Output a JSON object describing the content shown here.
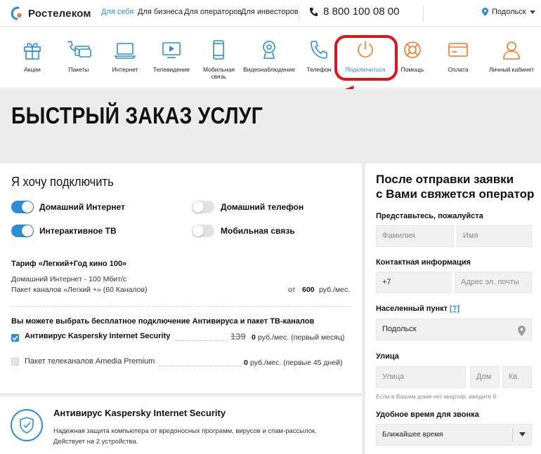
{
  "header": {
    "brand": "Ростелеком",
    "links": [
      "Для себя",
      "Для бизнеса",
      "Для операторов",
      "Для инвесторов"
    ],
    "phone": "8 800 100 08 00",
    "city": "Подольск"
  },
  "nav": {
    "items": [
      "Акции",
      "Пакеты",
      "Интернет",
      "Телевидение",
      "Мобильная связь",
      "Видеонаблюдение",
      "Телефон",
      "Подключиться",
      "Помощь",
      "Оплата",
      "Личный кабинет"
    ],
    "selected": "Подключиться"
  },
  "hero": {
    "title": "БЫСТРЫЙ ЗАКАЗ УСЛУГ"
  },
  "order": {
    "title": "Я хочу подключить",
    "toggles": [
      {
        "label": "Домашний Интернет",
        "on": true
      },
      {
        "label": "Домашний телефон",
        "on": false
      },
      {
        "label": "Интерактивное ТВ",
        "on": true
      },
      {
        "label": "Мобильная связь",
        "on": false
      }
    ],
    "tariff_title": "Тариф «Легкий+Год кино 100»",
    "tariff_line1": "Домашний Интернет - 100 Мбит/с",
    "tariff_line2": "Пакет каналов «Легкий +» (60 Каналов)",
    "price_prefix": "от",
    "price_value": "600",
    "price_unit": "руб./мес.",
    "free_title": "Вы можете выбрать бесплатное подключение Антивируса и пакет ТВ-каналов",
    "options": [
      {
        "label": "Антивирус Kaspersky Internet Security",
        "old_price": "139",
        "price": "0",
        "unit": "руб./мес. (первый месяц)",
        "checked": true
      },
      {
        "label": "Пакет телеканалов Amedia Premium",
        "price": "0",
        "unit": "руб./мес. (первые 45 дней)",
        "checked": false
      }
    ]
  },
  "promo": {
    "title": "Антивирус Kaspersky Internet Security",
    "line1": "Надежная защита компьютера от вредоносных программ, вирусов и спам-рассылок.",
    "line2": "Действует на 2 устройства."
  },
  "form": {
    "heading1": "После отправки заявки",
    "heading2": "с Вами свяжется оператор",
    "intro_label": "Представьтесь, пожалуйста",
    "surname_ph": "Фамилия",
    "name_ph": "Имя",
    "contact_label": "Контактная информация",
    "phone_prefix": "+7",
    "email_ph": "Адрес эл. почты",
    "locality_label": "Населенный пункт",
    "locality_help": "[?]",
    "locality_value": "Подольск",
    "street_label": "Улица",
    "street_ph": "Улица",
    "house_ph": "Дом",
    "apt_ph": "Кв.",
    "hint": "Если в Вашем доме нет квартир, введите 0",
    "time_label": "Удобное время для звонка",
    "time_value": "Ближайшее время"
  },
  "colors": {
    "accent": "#2c8ed8",
    "orange": "#f47920",
    "highlight": "#e3111c",
    "hero_bg": "#ececec"
  }
}
